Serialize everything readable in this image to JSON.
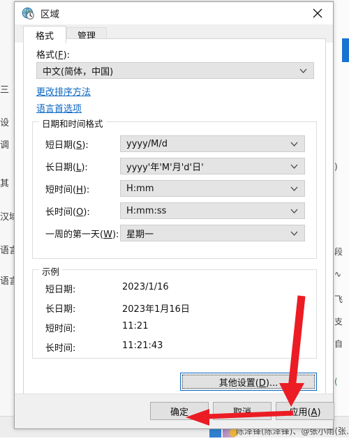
{
  "window": {
    "title": "区域",
    "icon": "globe-clock-icon",
    "close_label": "✕"
  },
  "tabs": [
    {
      "label": "格式",
      "active": true
    },
    {
      "label": "管理",
      "active": false
    }
  ],
  "format": {
    "label": "格式(F):",
    "label_plain": "格式",
    "accel": "F",
    "value": "中文(简体，中国)"
  },
  "links": [
    {
      "label": "更改排序方法"
    },
    {
      "label": "语言首选项"
    }
  ],
  "datetime_group": {
    "title": "日期和时间格式",
    "rows": [
      {
        "label_pre": "短日期(",
        "accel": "S",
        "label_post": "):",
        "value": "yyyy/M/d"
      },
      {
        "label_pre": "长日期(",
        "accel": "L",
        "label_post": "):",
        "value": "yyyy'年'M'月'd'日'"
      },
      {
        "label_pre": "短时间(",
        "accel": "H",
        "label_post": "):",
        "value": "H:mm"
      },
      {
        "label_pre": "长时间(",
        "accel": "O",
        "label_post": "):",
        "value": "H:mm:ss"
      },
      {
        "label_pre": "一周的第一天(",
        "accel": "W",
        "label_post": "):",
        "value": "星期一"
      }
    ]
  },
  "examples_group": {
    "title": "示例",
    "rows": [
      {
        "label": "短日期:",
        "value": "2023/1/16"
      },
      {
        "label": "长日期:",
        "value": "2023年1月16日"
      },
      {
        "label": "短时间:",
        "value": "11:21"
      },
      {
        "label": "长时间:",
        "value": "11:21:43"
      }
    ]
  },
  "buttons": {
    "additional_settings_pre": "其他设置(",
    "additional_settings_accel": "D",
    "additional_settings_post": ")...",
    "ok": "确定",
    "cancel": "取消",
    "apply_pre": "应用(",
    "apply_accel": "A",
    "apply_post": ")"
  },
  "annotations": {
    "arrow_color": "#ec1c24",
    "arrow_to_apply": "应用(A)",
    "arrow_to_ok": "确定"
  },
  "background": {
    "left_fragments": [
      "三",
      "设",
      "调",
      "其",
      "汉域",
      "语言",
      "语言"
    ],
    "right_fragments": [
      ")",
      "段",
      "∿",
      "飞",
      "∿",
      "支",
      "自",
      "("
    ],
    "bottom_text": "陈泽锋(陈泽锋)、@张小雨(张..."
  }
}
